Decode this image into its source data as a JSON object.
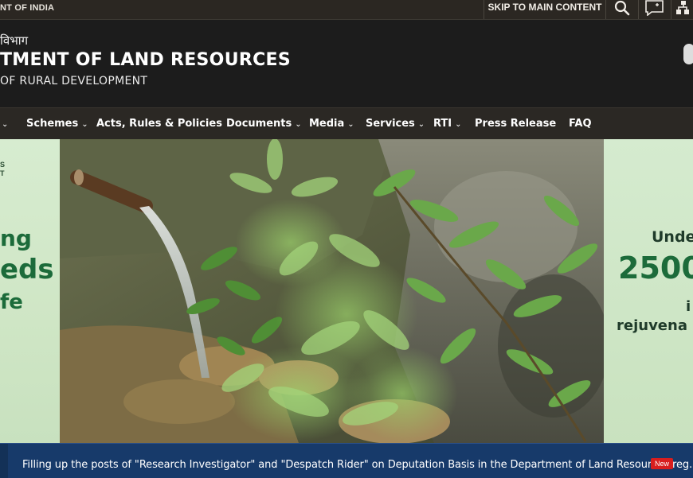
{
  "topbar": {
    "gov_text": "NT OF INDIA",
    "skip_label": "SKIP TO MAIN CONTENT",
    "icons": [
      "search-icon",
      "feedback-icon",
      "sitemap-icon"
    ]
  },
  "header": {
    "hindi": "विभाग",
    "title": "TMENT OF LAND RESOURCES",
    "subtitle": "OF RURAL DEVELOPMENT"
  },
  "nav": {
    "items": [
      {
        "label": "Schemes",
        "dropdown": true
      },
      {
        "label": "Acts, Rules & Policies",
        "dropdown": false
      },
      {
        "label": "Documents",
        "dropdown": true
      },
      {
        "label": "Media",
        "dropdown": true
      },
      {
        "label": "Services",
        "dropdown": true
      },
      {
        "label": "RTI",
        "dropdown": true
      },
      {
        "label": "Press Release",
        "dropdown": false
      },
      {
        "label": "FAQ",
        "dropdown": false
      }
    ]
  },
  "slider": {
    "left": {
      "small1": "S",
      "small2": "T",
      "line1": "ng",
      "line2": "eds",
      "line3": "fe"
    },
    "right": {
      "line1": "Unde",
      "line2": "2500",
      "line3": "i",
      "line4": "rejuvena"
    }
  },
  "ticker": {
    "text": "Filling up the posts of \"Research Investigator\" and \"Despatch Rider\" on Deputation Basis in the Department of Land Resources-reg.",
    "badge": "New"
  },
  "colors": {
    "nav_bg": "#2b2824",
    "header_bg": "#1c1c1c",
    "ticker_bg": "#173a6a",
    "badge_red": "#d81e1e",
    "slide_green": "#1c6b3a"
  }
}
